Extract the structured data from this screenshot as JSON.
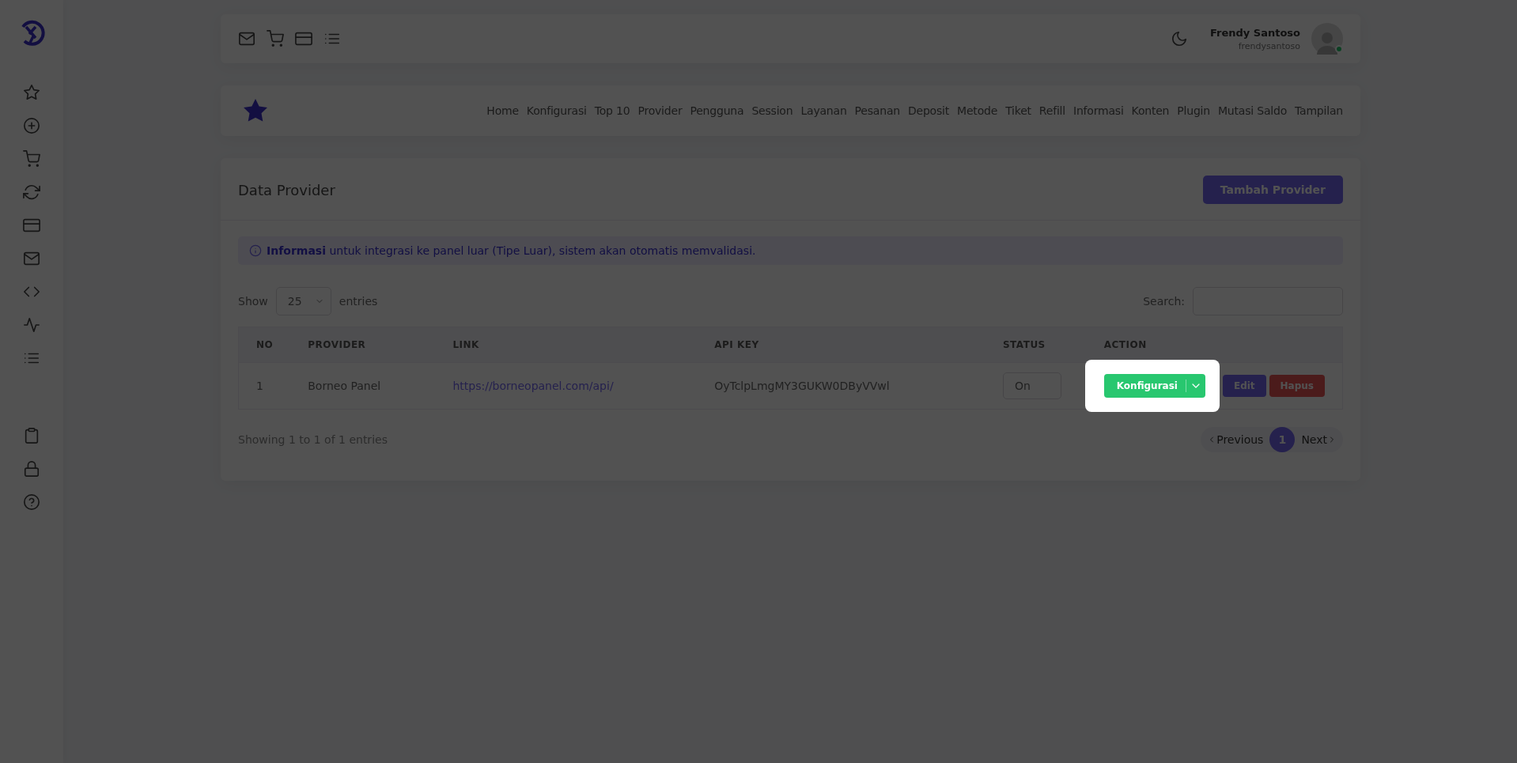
{
  "user": {
    "name": "Frendy Santoso",
    "username": "frendysantoso"
  },
  "nav": {
    "items": [
      "Home",
      "Konfigurasi",
      "Top 10",
      "Provider",
      "Pengguna",
      "Session",
      "Layanan",
      "Pesanan",
      "Deposit",
      "Metode",
      "Tiket",
      "Refill",
      "Informasi",
      "Konten",
      "Plugin",
      "Mutasi Saldo",
      "Tampilan"
    ]
  },
  "card": {
    "title": "Data Provider",
    "add_button": "Tambah Provider"
  },
  "alert": {
    "text": "**Informasi** untuk integrasi ke panel luar (Tipe Luar), sistem akan otomatis memvalidasi."
  },
  "length": {
    "show_label": "Show",
    "value": "25",
    "entries_label": "entries"
  },
  "search": {
    "label": "Search:"
  },
  "table": {
    "columns": [
      "NO",
      "PROVIDER",
      "LINK",
      "API KEY",
      "STATUS",
      "ACTION"
    ],
    "rows": [
      {
        "no": "1",
        "provider": "Borneo Panel",
        "link": "https://borneopanel.com/api/",
        "api_key": "OyTclpLmgMY3GUKW0DByVVwl",
        "status": "On",
        "actions": [
          {
            "label": "Konfigurasi",
            "kind": "split",
            "highlighted": true
          },
          {
            "label": "Edit",
            "kind": "edit",
            "highlighted": false
          },
          {
            "label": "Hapus",
            "kind": "delete",
            "highlighted": false
          }
        ]
      }
    ]
  },
  "info": "Showing 1 to 1 of 1 entries",
  "pagination": {
    "previous": "Previous",
    "pages": [
      {
        "label": "1",
        "selected": true
      }
    ],
    "next": "Next"
  }
}
